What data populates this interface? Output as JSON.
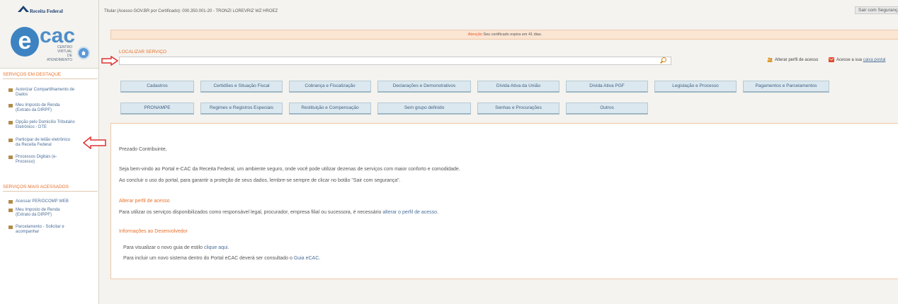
{
  "brand": {
    "receita": "Receita Federal",
    "ecac_e": "e",
    "ecac_cac": "cac",
    "ecac_sub1": "CENTRO VIRTUAL",
    "ecac_sub2": "DE ATENDIMENTO"
  },
  "header": {
    "holder": "Titular (Acesso GOV.BR por Certificado): 000.350.001-20 - TRONZI LOREVRIZ WZ HROEZ",
    "sair": "Sair com Segurança"
  },
  "warning": {
    "prefix": "Atenção",
    "text": " Seu certificado expira em 41 dias."
  },
  "search": {
    "label": "LOCALIZAR SERVIÇO",
    "placeholder": ""
  },
  "actions": {
    "alterar": "Alterar perfil de acesso",
    "caixa_prefix": "Acesse a sua ",
    "caixa_link": "caixa postal"
  },
  "sidebar": {
    "destaque_title": "SERVIÇOS EM DESTAQUE",
    "destaque": [
      {
        "l1": "Autorizar Compartilhamento de",
        "l2": "Dados"
      },
      {
        "l1": "Meu Imposto de Renda",
        "l2": "(Extrato da DIRPF)"
      },
      {
        "l1": "Opção pelo Domicílio Tributário",
        "l2": "Eletrônico - DTE"
      },
      {
        "l1": "Participar de leilão eletrônico",
        "l2": "da Receita Federal"
      },
      {
        "l1": "Processos Digitais (e-",
        "l2": "Processo)"
      }
    ],
    "acessados_title": "SERVIÇOS MAIS ACESSADOS",
    "acessados": [
      {
        "l1": "Acessar PER/DCOMP WEB",
        "l2": ""
      },
      {
        "l1": "Meu Imposto de Renda",
        "l2": "(Extrato da DIRPF)"
      },
      {
        "l1": "Parcelamento - Solicitar e",
        "l2": "acompanhar"
      }
    ]
  },
  "services": {
    "row1": [
      "Cadastros",
      "Certidões e Situação Fiscal",
      "Cobrança e Fiscalização",
      "Declarações e Demonstrativos",
      "Dívida Ativa da União",
      "Dívida Ativa PGF",
      "Legislação e Processo",
      "Pagamentos e Parcelamentos"
    ],
    "row2": [
      "PRONAMPE",
      "Regimes e Registros Especiais",
      "Restituição e Compensação",
      "Sem grupo definido",
      "Senhas e Procurações",
      "Outros"
    ]
  },
  "content": {
    "greeting": "Prezado Contribuinte,",
    "p1": "Seja bem-vindo ao Portal e-CAC da Receita Federal, um ambiente seguro, onde você pode utilizar dezenas de serviços com maior conforto e comodidade.",
    "p2": "Ao concluir o uso do portal, para garantir a proteção de seus dados, lembre-se sempre de clicar no botão \"Sair com segurança\".",
    "h_alterar": "Alterar perfil de acesso",
    "p3_prefix": "Para utilizar os serviços disponibilizados como responsável legal, procurador, empresa filial ou sucessora, é necessário ",
    "p3_link": "alterar o perfil de acesso",
    "p3_suffix": ".",
    "h_dev": "Informações ao Desenvolvedor",
    "p4_prefix": "Para visualizar o novo guia de estilo ",
    "p4_link": "clique aqui",
    "p4_suffix": ".",
    "p5_prefix": "Para incluir um novo sistema dentro do Portal eCAC deverá ser consultado o ",
    "p5_link": "Guia eCAC",
    "p5_suffix": "."
  },
  "colors": {
    "accent": "#e8702a",
    "link": "#4a6e9a",
    "button_bg": "#dce8ef",
    "arrow": "#e03030"
  }
}
